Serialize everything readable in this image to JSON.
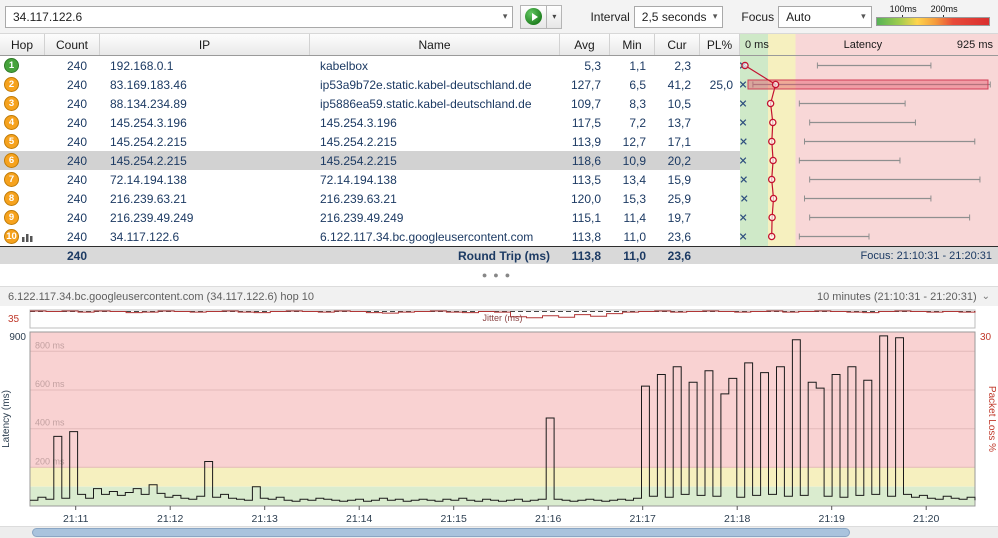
{
  "toolbar": {
    "target_value": "34.117.122.6",
    "interval_label": "Interval",
    "interval_value": "2,5 seconds",
    "focus_label": "Focus",
    "focus_value": "Auto",
    "legend_100": "100ms",
    "legend_200": "200ms"
  },
  "table": {
    "headers": {
      "hop": "Hop",
      "count": "Count",
      "ip": "IP",
      "name": "Name",
      "avg": "Avg",
      "min": "Min",
      "cur": "Cur",
      "pl": "PL%"
    },
    "latency_header": {
      "left": "0 ms",
      "center": "Latency",
      "right": "925 ms"
    },
    "rows": [
      {
        "hop": "1",
        "count": "240",
        "ip": "192.168.0.1",
        "name": "kabelbox",
        "avg": "5,3",
        "min": "1,1",
        "cur": "2,3",
        "pl": "",
        "badge": "green",
        "bar": [
          0.3,
          0.74
        ]
      },
      {
        "hop": "2",
        "count": "240",
        "ip": "83.169.183.46",
        "name": "ip53a9b72e.static.kabel-deutschland.de",
        "avg": "127,7",
        "min": "6,5",
        "cur": "41,2",
        "pl": "25,0",
        "badge": "orange",
        "bar": [
          0.05,
          0.97
        ],
        "highlight": true
      },
      {
        "hop": "3",
        "count": "240",
        "ip": "88.134.234.89",
        "name": "ip5886ea59.static.kabel-deutschland.de",
        "avg": "109,7",
        "min": "8,3",
        "cur": "10,5",
        "pl": "",
        "badge": "orange",
        "bar": [
          0.23,
          0.64
        ]
      },
      {
        "hop": "4",
        "count": "240",
        "ip": "145.254.3.196",
        "name": "145.254.3.196",
        "avg": "117,5",
        "min": "7,2",
        "cur": "13,7",
        "pl": "",
        "badge": "orange",
        "bar": [
          0.27,
          0.68
        ]
      },
      {
        "hop": "5",
        "count": "240",
        "ip": "145.254.2.215",
        "name": "145.254.2.215",
        "avg": "113,9",
        "min": "12,7",
        "cur": "17,1",
        "pl": "",
        "badge": "orange",
        "bar": [
          0.25,
          0.91
        ]
      },
      {
        "hop": "6",
        "count": "240",
        "ip": "145.254.2.215",
        "name": "145.254.2.215",
        "avg": "118,6",
        "min": "10,9",
        "cur": "20,2",
        "pl": "",
        "badge": "orange",
        "bar": [
          0.23,
          0.62
        ],
        "selected": true
      },
      {
        "hop": "7",
        "count": "240",
        "ip": "72.14.194.138",
        "name": "72.14.194.138",
        "avg": "113,5",
        "min": "13,4",
        "cur": "15,9",
        "pl": "",
        "badge": "orange",
        "bar": [
          0.27,
          0.93
        ]
      },
      {
        "hop": "8",
        "count": "240",
        "ip": "216.239.63.21",
        "name": "216.239.63.21",
        "avg": "120,0",
        "min": "15,3",
        "cur": "25,9",
        "pl": "",
        "badge": "orange",
        "bar": [
          0.25,
          0.74
        ]
      },
      {
        "hop": "9",
        "count": "240",
        "ip": "216.239.49.249",
        "name": "216.239.49.249",
        "avg": "115,1",
        "min": "11,4",
        "cur": "19,7",
        "pl": "",
        "badge": "orange",
        "bar": [
          0.27,
          0.89
        ]
      },
      {
        "hop": "10",
        "count": "240",
        "ip": "34.117.122.6",
        "name": "6.122.117.34.bc.googleusercontent.com",
        "avg": "113,8",
        "min": "11,0",
        "cur": "23,6",
        "pl": "",
        "badge": "orange",
        "bar": [
          0.23,
          0.5
        ],
        "focused": true
      }
    ],
    "footer": {
      "count": "240",
      "label": "Round Trip (ms)",
      "avg": "113,8",
      "min": "11,0",
      "cur": "23,6",
      "focus": "Focus: 21:10:31 - 21:20:31"
    }
  },
  "timeline": {
    "title": "6.122.117.34.bc.googleusercontent.com (34.117.122.6) hop 10",
    "range_label": "10 minutes (21:10:31 - 21:20:31)",
    "jitter_label": "Jitter (ms)",
    "jitter_max": "35",
    "latency_max": "900",
    "packet_loss_max": "30",
    "y_left_label": "Latency (ms)",
    "y_right_label": "Packet Loss %",
    "gridline_labels": [
      "800 ms",
      "600 ms",
      "400 ms",
      "200 ms"
    ]
  },
  "chart_data": {
    "type": "line",
    "title": "Hop 10 latency over time",
    "x_range": [
      "21:10:31",
      "21:20:31"
    ],
    "x_ticks": [
      "21:11",
      "21:12",
      "21:13",
      "21:14",
      "21:15",
      "21:16",
      "21:17",
      "21:18",
      "21:19",
      "21:20"
    ],
    "ylim": [
      0,
      900
    ],
    "series": [
      {
        "name": "Latency (ms)",
        "ymax": 900,
        "values": [
          30,
          45,
          35,
          360,
          40,
          385,
          60,
          40,
          90,
          60,
          75,
          55,
          70,
          90,
          60,
          110,
          65,
          45,
          55,
          40,
          35,
          50,
          230,
          45,
          60,
          40,
          35,
          30,
          100,
          40,
          35,
          45,
          30,
          25,
          35,
          30,
          40,
          35,
          30,
          25,
          30,
          35,
          25,
          30,
          40,
          30,
          35,
          25,
          30,
          35,
          30,
          25,
          35,
          30,
          40,
          30,
          25,
          35,
          30,
          25,
          30,
          35,
          25,
          30,
          35,
          455,
          35,
          30,
          25,
          30,
          35,
          30,
          25,
          30,
          35,
          30,
          40,
          620,
          50,
          680,
          45,
          720,
          60,
          640,
          55,
          700,
          50,
          580,
          660,
          45,
          740,
          55,
          690,
          60,
          720,
          50,
          860,
          55,
          640,
          610,
          50,
          680,
          45,
          720,
          55,
          650,
          60,
          880,
          50,
          870,
          60,
          45,
          55,
          40,
          35,
          50,
          40,
          35,
          45,
          30
        ]
      },
      {
        "name": "Jitter (ms)",
        "ymax": 35,
        "values": [
          33,
          32,
          33,
          31,
          33,
          32,
          30,
          31,
          33,
          32,
          31,
          32,
          33,
          31,
          30,
          32,
          33,
          32,
          31,
          33,
          32,
          30,
          29,
          31,
          32,
          33,
          31,
          30,
          32,
          31,
          22,
          20,
          24,
          21,
          26,
          23,
          28,
          31,
          32,
          33,
          31,
          32,
          33,
          32,
          31,
          32,
          33,
          31,
          32,
          33,
          32,
          31,
          30,
          32,
          33,
          32,
          31,
          32,
          31,
          33
        ]
      }
    ]
  }
}
